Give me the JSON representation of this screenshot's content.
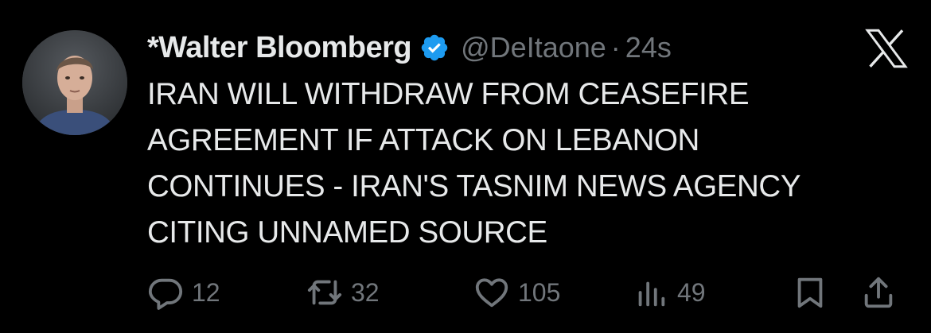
{
  "author": {
    "display_name": "*Walter Bloomberg",
    "handle": "@DeItaone",
    "separator": "·",
    "timestamp": "24s",
    "verified_color": "#1d9bf0"
  },
  "tweet": {
    "text": "IRAN WILL WITHDRAW FROM CEASEFIRE\nAGREEMENT IF ATTACK ON LEBANON\nCONTINUES - IRAN'S TASNIM NEWS AGENCY\nCITING UNNAMED SOURCE"
  },
  "actions": {
    "replies": "12",
    "reposts": "32",
    "likes": "105",
    "views": "49"
  },
  "icons": [
    "avatar",
    "verified-badge-icon",
    "x-logo-icon",
    "reply-icon",
    "repost-icon",
    "like-icon",
    "views-icon",
    "bookmark-icon",
    "share-icon"
  ],
  "colors": {
    "background": "#000000",
    "text": "#e7e9ea",
    "muted": "#71767b",
    "accent": "#1d9bf0"
  }
}
